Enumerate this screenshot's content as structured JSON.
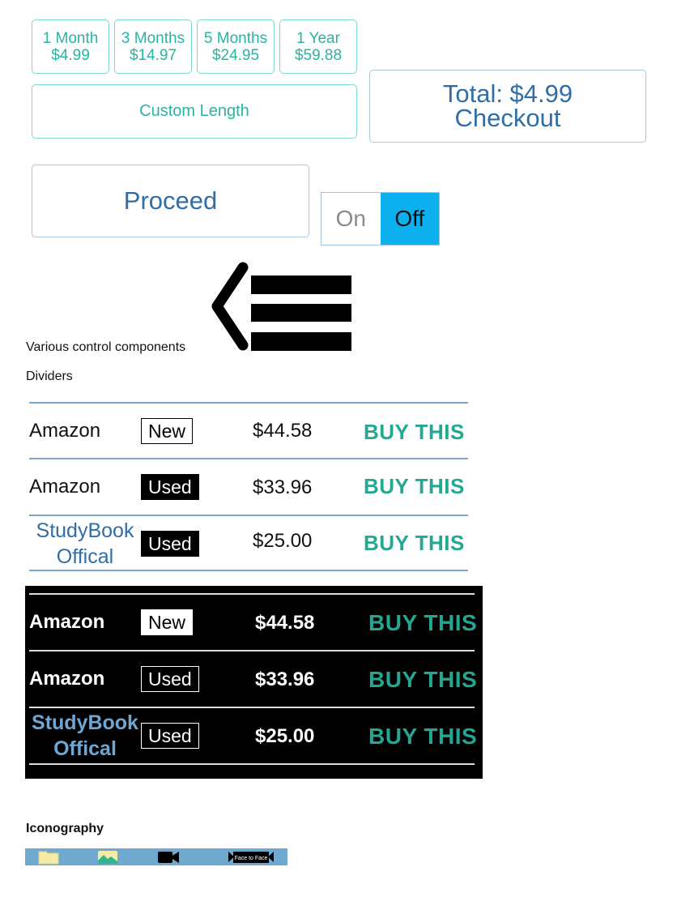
{
  "plans": [
    {
      "name": "1 Month",
      "price": "$4.99"
    },
    {
      "name": "3 Months",
      "price": "$14.97"
    },
    {
      "name": "5 Months",
      "price": "$24.95"
    },
    {
      "name": "1 Year",
      "price": "$59.88"
    }
  ],
  "custom_length_label": "Custom Length",
  "checkout": {
    "total": "Total: $4.99",
    "label": "Checkout"
  },
  "proceed_label": "Proceed",
  "toggle": {
    "on_label": "On",
    "off_label": "Off",
    "selected": "Off"
  },
  "captions": {
    "controls": "Various control components",
    "dividers": "Dividers",
    "iconography": "Iconography"
  },
  "listings_light": [
    {
      "seller": "Amazon",
      "condition": "New",
      "price": "$44.58",
      "action": "BUY THIS"
    },
    {
      "seller": "Amazon",
      "condition": "Used",
      "price": "$33.96",
      "action": "BUY THIS"
    },
    {
      "seller": "StudyBook Offical",
      "seller_line1": "StudyBook",
      "seller_line2": "Offical",
      "condition": "Used",
      "price": "$25.00",
      "action": "BUY THIS"
    }
  ],
  "listings_dark": [
    {
      "seller": "Amazon",
      "condition": "New",
      "price": "$44.58",
      "action": "BUY THIS"
    },
    {
      "seller": "Amazon",
      "condition": "Used",
      "price": "$33.96",
      "action": "BUY THIS"
    },
    {
      "seller": "StudyBook Offical",
      "seller_line1": "StudyBook",
      "seller_line2": "Offical",
      "condition": "Used",
      "price": "$25.00",
      "action": "BUY THIS"
    }
  ],
  "icons": [
    "folder-icon",
    "image-icon",
    "video-camera-icon",
    "face-to-face-icon"
  ],
  "face_to_face_label": "Face to Face",
  "colors": {
    "teal": "#2ab3a3",
    "blue_text": "#2f6ea6",
    "toggle_active": "#0cb0ef",
    "icon_bar": "#6fa9cf",
    "buy": "#23a893"
  }
}
